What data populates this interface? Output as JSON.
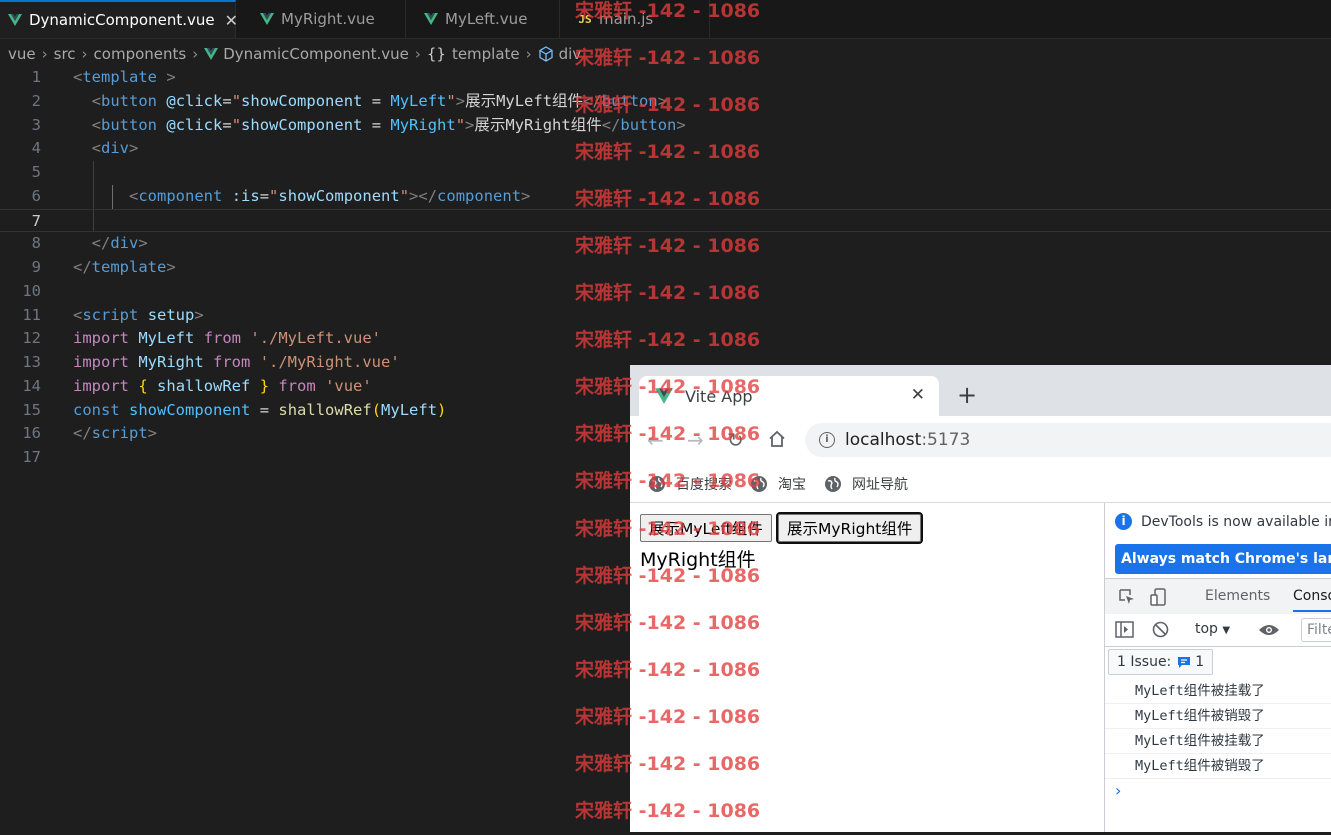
{
  "editor": {
    "tabs": [
      {
        "label": "DynamicComponent.vue",
        "close": "✕"
      },
      {
        "label": "MyRight.vue"
      },
      {
        "label": "MyLeft.vue"
      },
      {
        "label": "main.js",
        "icon_text": "JS"
      }
    ],
    "breadcrumb": [
      "vue",
      "src",
      "components",
      "DynamicComponent.vue",
      "template",
      "div"
    ],
    "breadcrumb_template_glyph": "{}",
    "line_numbers": [
      "1",
      "2",
      "3",
      "4",
      "5",
      "6",
      "7",
      "8",
      "9",
      "10",
      "11",
      "12",
      "13",
      "14",
      "15",
      "16",
      "17"
    ],
    "current_line": "7",
    "colors": {
      "tag": "#569cd6",
      "attr": "#9cdcfe",
      "string": "#ce9178",
      "keyword": "#c586c0",
      "function": "#dcdcaa",
      "active_tab_border": "#0078d4"
    }
  },
  "watermark": {
    "text": "宋雅轩 -142 - 1086",
    "color": "#e23c3c"
  },
  "browser": {
    "tab_title": "Vite App",
    "tab_close": "✕",
    "new_tab": "+",
    "nav": {
      "back": "←",
      "forward": "→",
      "reload": "↻"
    },
    "url_host": "localhost",
    "url_port": ":5173",
    "info_glyph": "i",
    "bookmarks": [
      "百度搜索",
      "淘宝",
      "网址导航"
    ],
    "page": {
      "buttons": [
        "展示MyLeft组件",
        "展示MyRight组件"
      ],
      "rendered_component": "MyRight组件"
    },
    "devtools": {
      "notice": "DevTools is now available in C",
      "match_button": "Always match Chrome's langua",
      "tabs": [
        "Elements",
        "Conso"
      ],
      "context": "top",
      "context_arrow": "▼",
      "filter_placeholder": "Filte",
      "issues_label": "1 Issue:",
      "issues_count": "1",
      "logs": [
        "MyLeft组件被挂载了",
        "MyLeft组件被销毁了",
        "MyLeft组件被挂载了",
        "MyLeft组件被销毁了"
      ],
      "prompt": "›"
    }
  }
}
